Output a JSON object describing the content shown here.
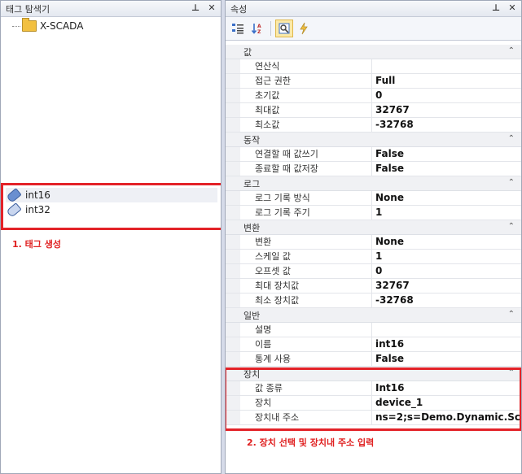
{
  "left_panel": {
    "title": "태그 탐색기",
    "pin_icon": "⊥",
    "close_icon": "✕",
    "root": "X-SCADA",
    "tags": [
      {
        "label": "int16",
        "selected": true
      },
      {
        "label": "int32",
        "selected": false
      }
    ],
    "annotation": "1. 태그 생성"
  },
  "right_panel": {
    "title": "속성",
    "pin_icon": "⊥",
    "close_icon": "✕",
    "categories": [
      {
        "name": "값",
        "rows": [
          {
            "name": "연산식",
            "value": ""
          },
          {
            "name": "접근 권한",
            "value": "Full"
          },
          {
            "name": "초기값",
            "value": "0"
          },
          {
            "name": "최대값",
            "value": "32767"
          },
          {
            "name": "최소값",
            "value": "-32768"
          }
        ]
      },
      {
        "name": "동작",
        "rows": [
          {
            "name": "연결할 때 값쓰기",
            "value": "False"
          },
          {
            "name": "종료할 때 값저장",
            "value": "False"
          }
        ]
      },
      {
        "name": "로그",
        "rows": [
          {
            "name": "로그 기록 방식",
            "value": "None"
          },
          {
            "name": "로그 기록 주기",
            "value": "1"
          }
        ]
      },
      {
        "name": "변환",
        "rows": [
          {
            "name": "변환",
            "value": "None"
          },
          {
            "name": "스케일 값",
            "value": "1"
          },
          {
            "name": "오프셋 값",
            "value": "0"
          },
          {
            "name": "최대 장치값",
            "value": "32767"
          },
          {
            "name": "최소 장치값",
            "value": "-32768"
          }
        ]
      },
      {
        "name": "일반",
        "rows": [
          {
            "name": "설명",
            "value": ""
          },
          {
            "name": "이름",
            "value": "int16"
          },
          {
            "name": "통계 사용",
            "value": "False"
          }
        ]
      },
      {
        "name": "장치",
        "rows": [
          {
            "name": "값 종류",
            "value": "Int16"
          },
          {
            "name": "장치",
            "value": "device_1"
          },
          {
            "name": "장치내 주소",
            "value": "ns=2;s=Demo.Dynamic.Sc..."
          }
        ]
      }
    ],
    "annotation": "2. 장치 선택 및 장치내 주소 입력"
  }
}
